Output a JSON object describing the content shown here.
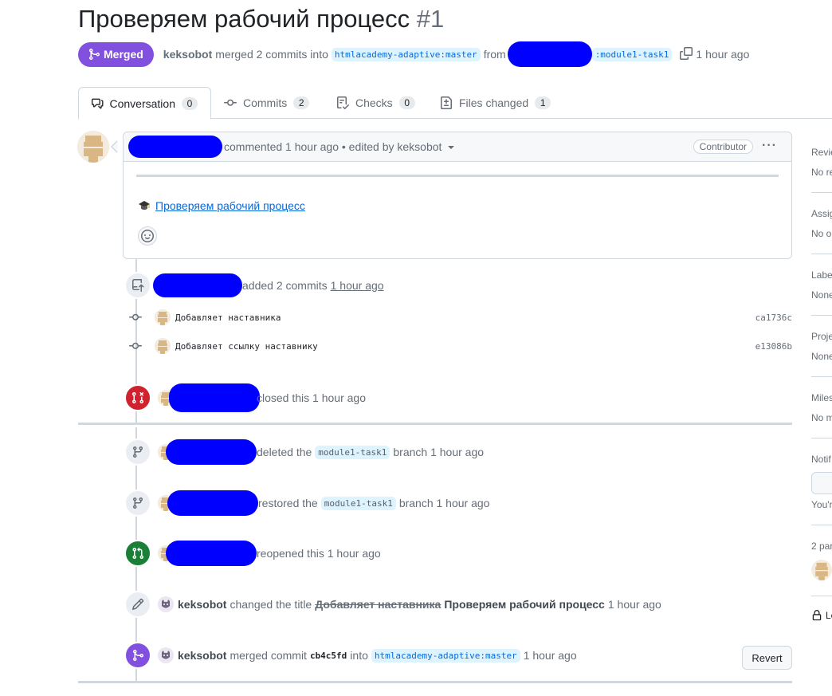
{
  "pr": {
    "title": "Проверяем рабочий процесс",
    "number": "#1",
    "state": "Merged",
    "author": "keksobot",
    "merge_text": "merged 2 commits into",
    "base_ref": "htmlacademy-adaptive:master",
    "from_text": "from",
    "head_ref": ":module1-task1",
    "time": "1 hour ago"
  },
  "tabs": [
    {
      "label": "Conversation",
      "count": "0",
      "icon": "comment-discussion-icon"
    },
    {
      "label": "Commits",
      "count": "2",
      "icon": "git-commit-icon"
    },
    {
      "label": "Checks",
      "count": "0",
      "icon": "checklist-icon"
    },
    {
      "label": "Files changed",
      "count": "1",
      "icon": "file-diff-icon"
    }
  ],
  "comment": {
    "action": "commented 1 hour ago • edited by keksobot",
    "role": "Contributor",
    "link_text": "Проверяем рабочий процесс"
  },
  "events": {
    "added": {
      "text": "added 2 commits",
      "time": "1 hour ago"
    },
    "commits": [
      {
        "message": "Добавляет наставника",
        "sha": "ca1736c"
      },
      {
        "message": "Добавляет ссылку наставнику",
        "sha": "e13086b"
      }
    ],
    "closed": {
      "text": "closed this 1 hour ago"
    },
    "deleted": {
      "pre": "deleted the",
      "branch": "module1-task1",
      "post": "branch 1 hour ago"
    },
    "restored": {
      "pre": "restored the",
      "branch": "module1-task1",
      "post": "branch 1 hour ago"
    },
    "reopened": {
      "text": "reopened this 1 hour ago"
    },
    "renamed": {
      "actor": "keksobot",
      "text": "changed the title",
      "old": "Добавляет наставника",
      "new": "Проверяем рабочий процесс",
      "time": "1 hour ago"
    },
    "merged": {
      "actor": "keksobot",
      "text": "merged commit",
      "sha": "cb4c5fd",
      "into": "into",
      "ref": "htmlacademy-adaptive:master",
      "time": "1 hour ago"
    },
    "revert_label": "Revert"
  },
  "sidebar": {
    "reviewers": {
      "h": "Revie",
      "v": "No re"
    },
    "assignees": {
      "h": "Assig",
      "v": "No o"
    },
    "labels": {
      "h": "Labe",
      "v": "None"
    },
    "projects": {
      "h": "Proje",
      "v": "None"
    },
    "milestone": {
      "h": "Miles",
      "v": "No m"
    },
    "notifications": {
      "h": "Notif",
      "v": "You'r"
    },
    "participants": {
      "h": "2 par"
    },
    "lock": {
      "h": "Lo"
    }
  },
  "colors": {
    "merged": "#8250df",
    "closed": "#cf222e",
    "reopened": "#1a7f37",
    "link": "#0969da",
    "redaction": "#0000ff"
  }
}
